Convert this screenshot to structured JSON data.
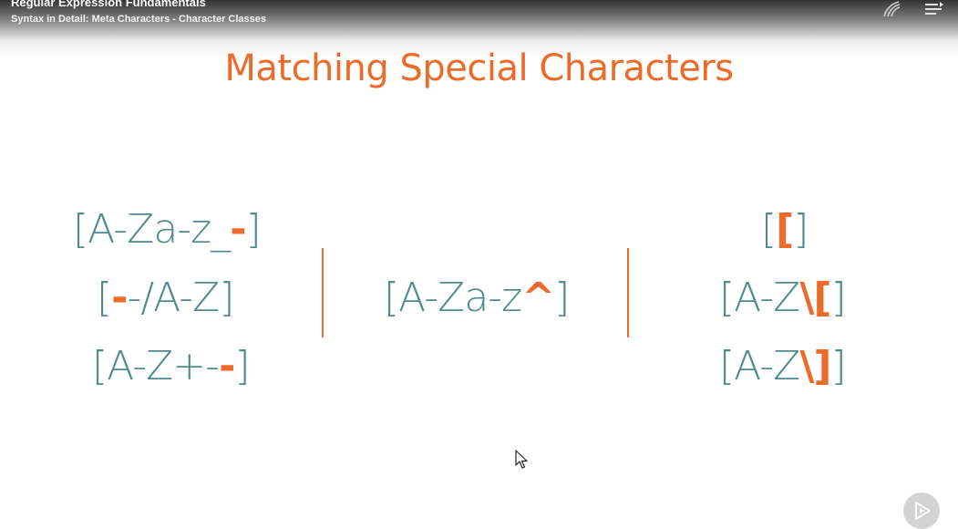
{
  "header": {
    "course_title": "Regular Expression Fundamentals",
    "module_title": "Syntax in Detail: Meta Characters - Character Classes",
    "icons": [
      "bookmark-icon",
      "table-of-contents-icon"
    ]
  },
  "slide": {
    "title": "Matching Special Characters",
    "left_column": [
      {
        "plain_before": "[A-Za-z_",
        "highlight": "-",
        "plain_after": "]"
      },
      {
        "plain_before": "[",
        "highlight": "-",
        "plain_after": "-/A-Z]"
      },
      {
        "plain_before": "[A-Z+-",
        "highlight": "-",
        "plain_after": "]"
      }
    ],
    "middle_column": [
      {
        "plain_before": "[A-Za-z",
        "highlight": "^",
        "plain_after": "]"
      }
    ],
    "right_column": [
      {
        "plain_before": "[",
        "highlight": "[",
        "plain_after": "]"
      },
      {
        "plain_before": "[A-Z",
        "highlight": "\\[",
        "plain_after": "]"
      },
      {
        "plain_before": "[A-Z",
        "highlight": "\\]",
        "plain_after": "]"
      }
    ]
  },
  "colors": {
    "accent": "#ec6b2a",
    "text": "#4e8a8f",
    "play_button": "#d3d3d3"
  },
  "player": {
    "play_icon": "play-icon"
  }
}
